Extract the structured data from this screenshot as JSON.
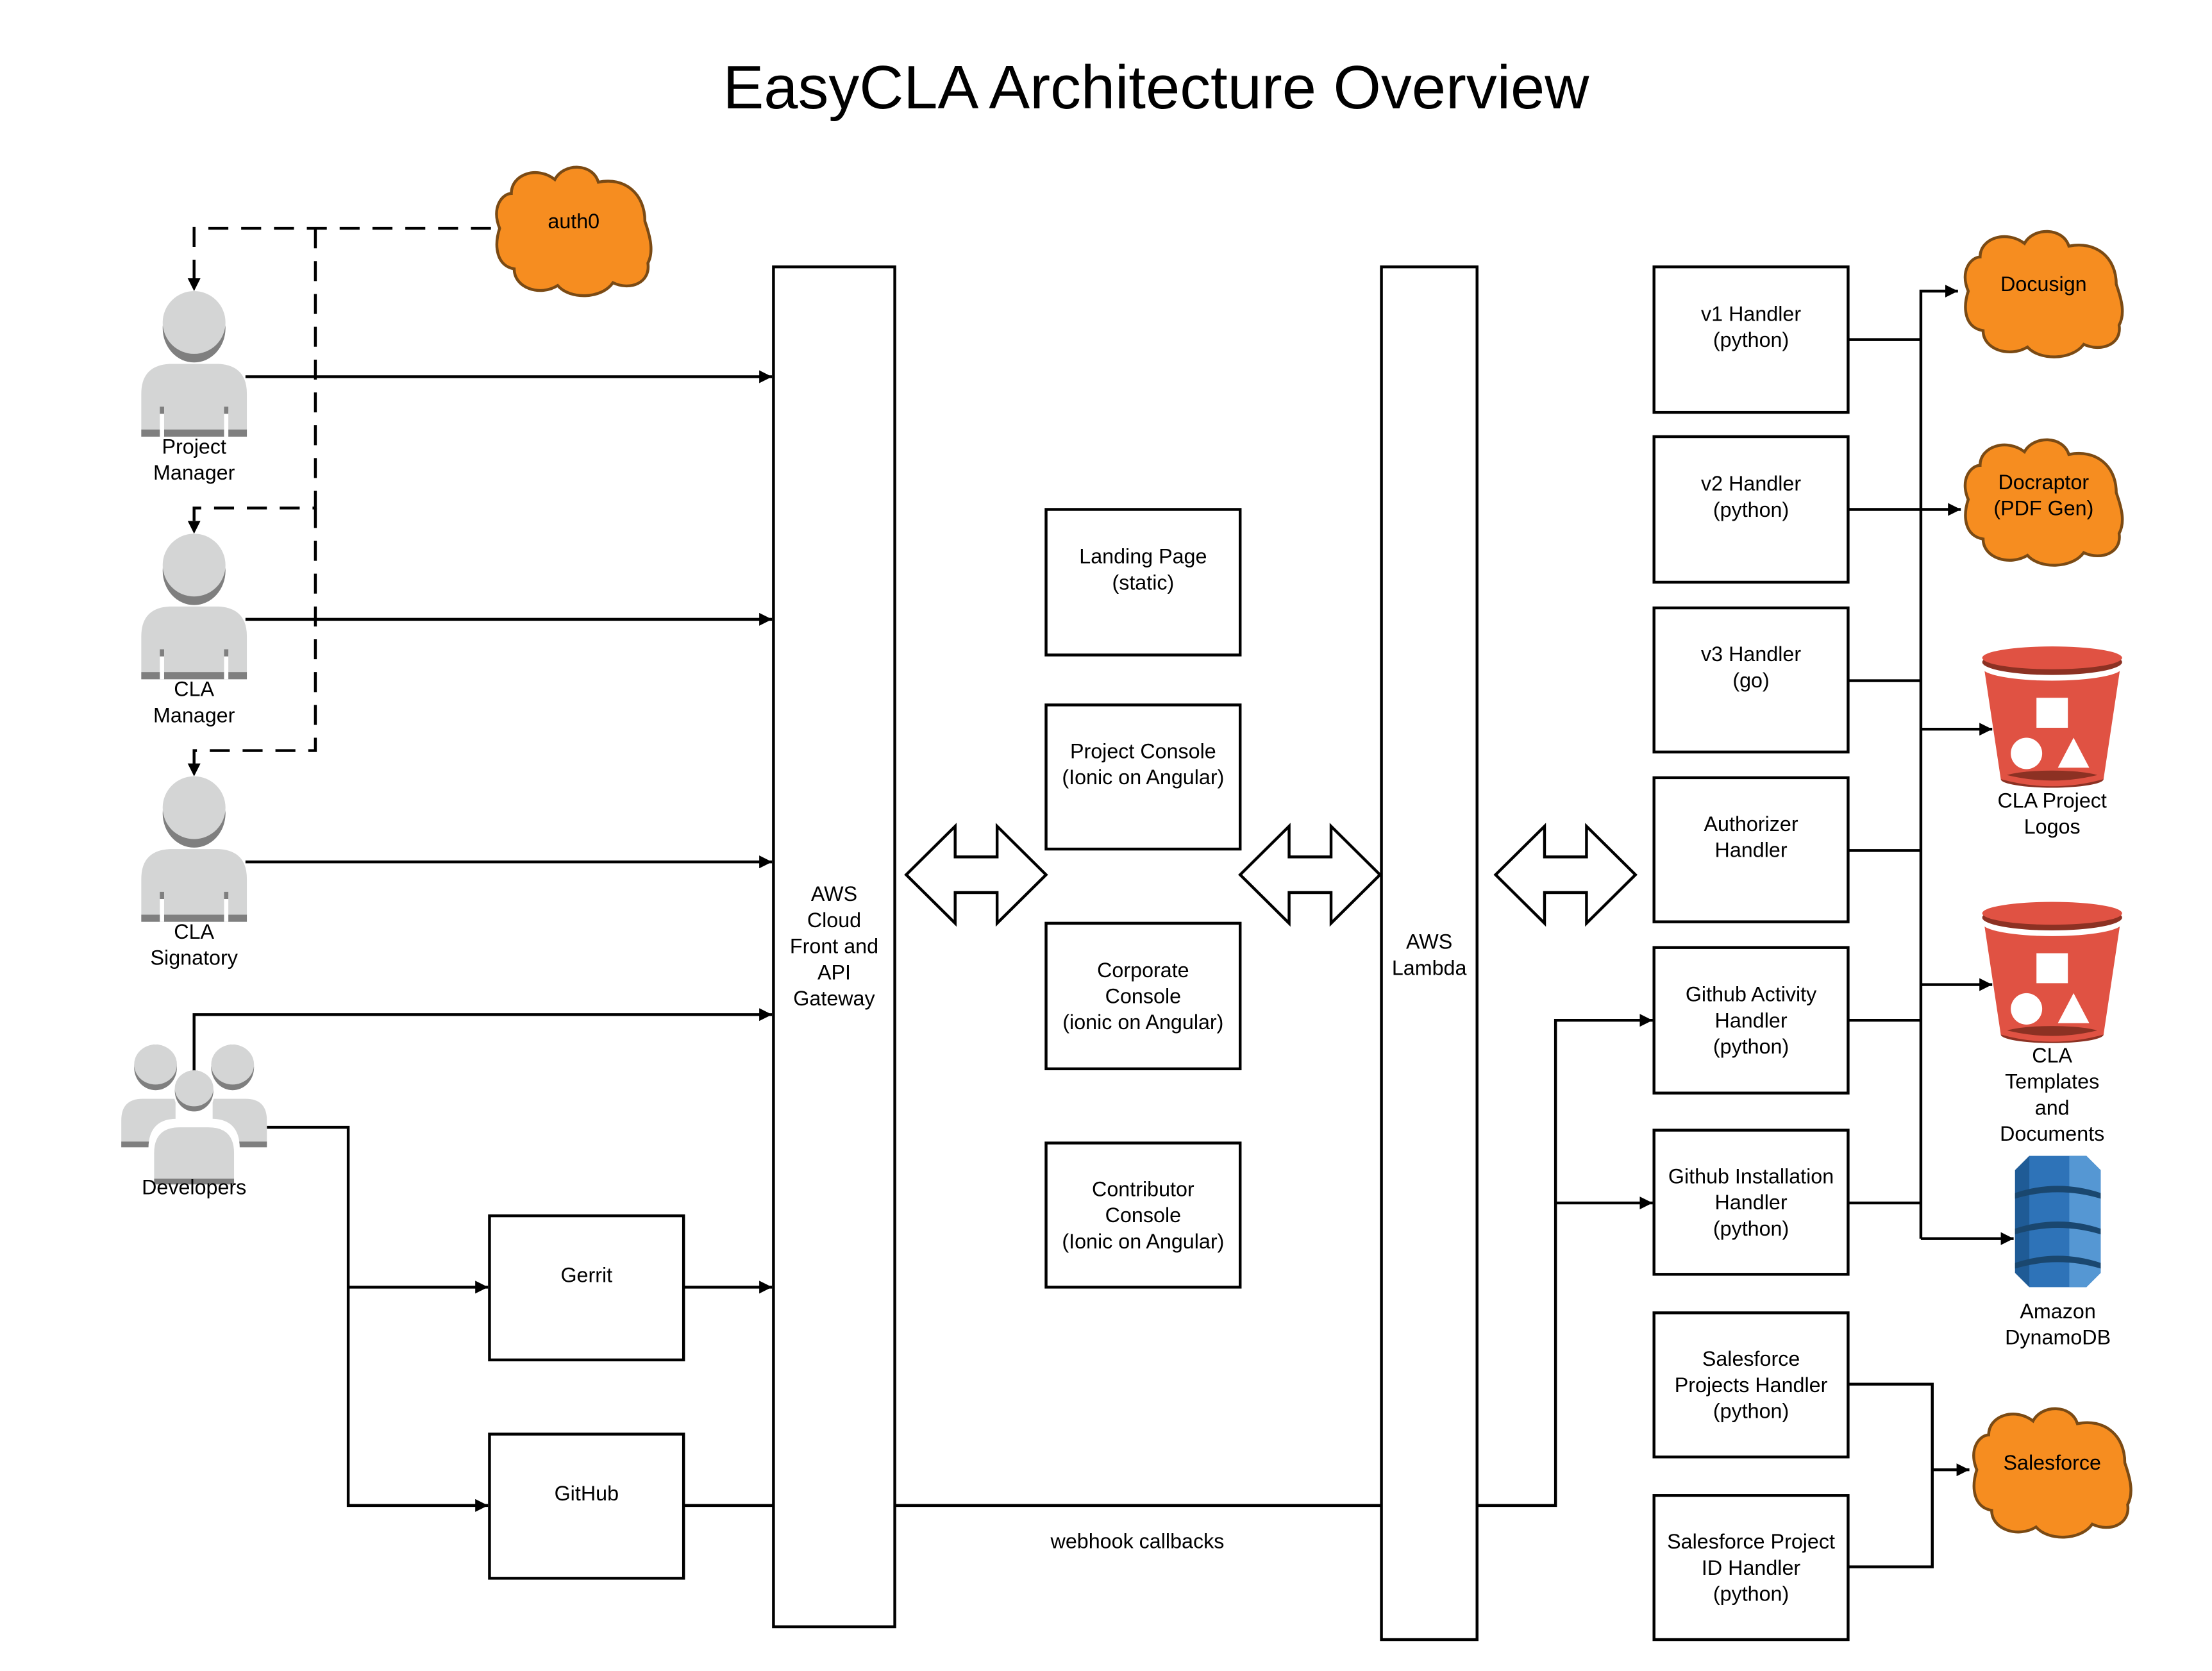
{
  "title": "EasyCLA  Architecture Overview",
  "colors": {
    "cloud_fill": "#f68d20",
    "cloud_stroke": "#7a4a14",
    "bucket_red": "#e05243",
    "bucket_dark": "#8c3123",
    "dynamo_blue": "#2e73b8",
    "dynamo_dark": "#1a476f",
    "person_light": "#d4d5d5",
    "person_dark": "#7f7f7f"
  },
  "actors": [
    {
      "id": "project-manager",
      "icon": "person-icon",
      "label": [
        "Project",
        "Manager"
      ]
    },
    {
      "id": "cla-manager",
      "icon": "person-icon",
      "label": [
        "CLA",
        "Manager"
      ]
    },
    {
      "id": "cla-signatory",
      "icon": "person-icon",
      "label": [
        "CLA",
        "Signatory"
      ]
    },
    {
      "id": "developers",
      "icon": "people-group-icon",
      "label": [
        "Developers"
      ]
    }
  ],
  "external_services": [
    {
      "id": "auth0",
      "icon": "cloud-icon",
      "label": [
        "auth0"
      ]
    },
    {
      "id": "docusign",
      "icon": "cloud-icon",
      "label": [
        "Docusign"
      ]
    },
    {
      "id": "docraptor",
      "icon": "cloud-icon",
      "label": [
        "Docraptor",
        "(PDF Gen)"
      ]
    },
    {
      "id": "salesforce",
      "icon": "cloud-icon",
      "label": [
        "Salesforce"
      ]
    }
  ],
  "storage": [
    {
      "id": "cla-project-logos",
      "icon": "s3-bucket-icon",
      "label": [
        "CLA Project",
        "Logos"
      ]
    },
    {
      "id": "cla-templates",
      "icon": "s3-bucket-icon",
      "label": [
        "CLA",
        "Templates",
        "and",
        "Documents"
      ]
    },
    {
      "id": "dynamodb",
      "icon": "dynamodb-icon",
      "label": [
        "Amazon",
        "DynamoDB"
      ]
    }
  ],
  "components": [
    {
      "id": "gateway",
      "label": [
        "AWS",
        "Cloud",
        "Front and",
        "API",
        "Gateway"
      ]
    },
    {
      "id": "landing-page",
      "label": [
        "Landing Page",
        "(static)"
      ]
    },
    {
      "id": "project-console",
      "label": [
        "Project Console",
        "(Ionic on Angular)"
      ]
    },
    {
      "id": "corporate-console",
      "label": [
        "Corporate",
        "Console",
        "(ionic on Angular)"
      ]
    },
    {
      "id": "contributor-console",
      "label": [
        "Contributor",
        "Console",
        "(Ionic on Angular)"
      ]
    },
    {
      "id": "lambda",
      "label": [
        "AWS",
        "Lambda"
      ]
    },
    {
      "id": "gerrit",
      "label": [
        "Gerrit"
      ]
    },
    {
      "id": "github",
      "label": [
        "GitHub"
      ]
    },
    {
      "id": "v1-handler",
      "label": [
        "v1 Handler",
        "(python)"
      ]
    },
    {
      "id": "v2-handler",
      "label": [
        "v2 Handler",
        "(python)"
      ]
    },
    {
      "id": "v3-handler",
      "label": [
        "v3 Handler",
        "(go)"
      ]
    },
    {
      "id": "authorizer-handler",
      "label": [
        "Authorizer",
        "Handler"
      ]
    },
    {
      "id": "github-activity-handler",
      "label": [
        "Github Activity",
        "Handler",
        "(python)"
      ]
    },
    {
      "id": "github-installation-handler",
      "label": [
        "Github Installation",
        "Handler",
        "(python)"
      ]
    },
    {
      "id": "salesforce-projects-handler",
      "label": [
        "Salesforce",
        "Projects Handler",
        "(python)"
      ]
    },
    {
      "id": "salesforce-project-id-handler",
      "label": [
        "Salesforce Project",
        "ID Handler",
        "(python)"
      ]
    }
  ],
  "edge_labels": {
    "webhook": "webhook callbacks"
  },
  "connections": [
    {
      "from": "auth0",
      "to": "project-manager",
      "style": "dashed"
    },
    {
      "from": "auth0",
      "to": "cla-manager",
      "style": "dashed"
    },
    {
      "from": "auth0",
      "to": "cla-signatory",
      "style": "dashed"
    },
    {
      "from": "project-manager",
      "to": "gateway",
      "style": "solid"
    },
    {
      "from": "cla-manager",
      "to": "gateway",
      "style": "solid"
    },
    {
      "from": "cla-signatory",
      "to": "gateway",
      "style": "solid"
    },
    {
      "from": "developers",
      "to": "gateway",
      "style": "solid"
    },
    {
      "from": "developers",
      "to": "gerrit",
      "style": "solid"
    },
    {
      "from": "developers",
      "to": "github",
      "style": "solid"
    },
    {
      "from": "gerrit",
      "to": "gateway",
      "style": "solid"
    },
    {
      "from": "github",
      "to": "github-activity-handler",
      "style": "solid",
      "label": "webhook callbacks"
    },
    {
      "from": "github",
      "to": "github-installation-handler",
      "style": "solid"
    },
    {
      "from": "gateway",
      "to": "ui-consoles",
      "style": "bidirectional"
    },
    {
      "from": "ui-consoles",
      "to": "lambda",
      "style": "bidirectional"
    },
    {
      "from": "lambda",
      "to": "handlers",
      "style": "bidirectional"
    },
    {
      "from": "handlers",
      "to": "docusign",
      "style": "solid"
    },
    {
      "from": "handlers",
      "to": "docraptor",
      "style": "solid"
    },
    {
      "from": "handlers",
      "to": "cla-project-logos",
      "style": "solid"
    },
    {
      "from": "handlers",
      "to": "cla-templates",
      "style": "solid"
    },
    {
      "from": "handlers",
      "to": "dynamodb",
      "style": "solid"
    },
    {
      "from": "salesforce-projects-handler",
      "to": "salesforce",
      "style": "solid"
    },
    {
      "from": "salesforce-project-id-handler",
      "to": "salesforce",
      "style": "solid"
    }
  ]
}
